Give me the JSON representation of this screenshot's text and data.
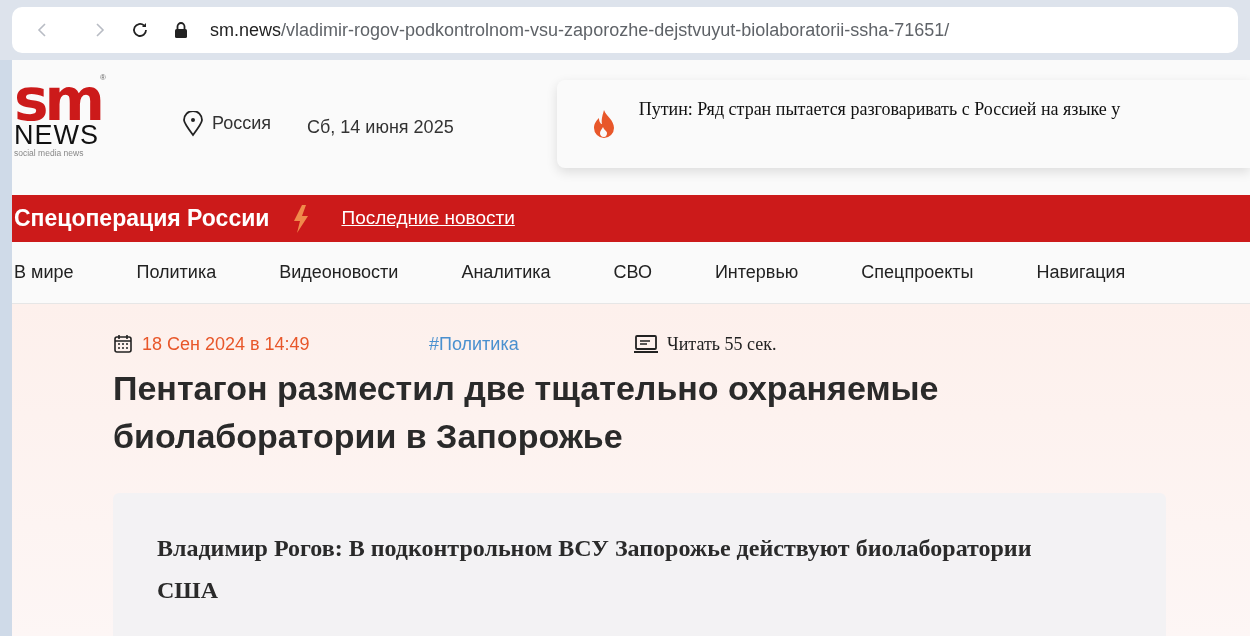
{
  "browser": {
    "url_host": "sm.news",
    "url_path": "/vladimir-rogov-podkontrolnom-vsu-zaporozhe-dejstvuyut-biolaboratorii-ssha-71651/",
    "back_disabled": true,
    "forward_disabled": true
  },
  "header": {
    "logo": {
      "mark": "sm",
      "word": "NEWS",
      "tagline": "social media news",
      "registered": "®"
    },
    "region": "Россия",
    "date": "Сб, 14 июня 2025",
    "ticker": "Путин: Ряд стран пытается разговаривать с Россией на языке у"
  },
  "banner": {
    "title": "Спецоперация России",
    "link": "Последние новости"
  },
  "nav": [
    "В мире",
    "Политика",
    "Видеоновости",
    "Аналитика",
    "СВО",
    "Интервью",
    "Спецпроекты",
    "Навигация"
  ],
  "article": {
    "date": "18 Сен 2024 в 14:49",
    "tag": "#Политика",
    "read_time": "Читать 55 сек.",
    "title": "Пентагон разместил две тщательно охраняемые биолаборатории в Запорожье",
    "lead": "Владимир Рогов: В подконтрольном ВСУ Запорожье действуют биолаборатории США"
  }
}
